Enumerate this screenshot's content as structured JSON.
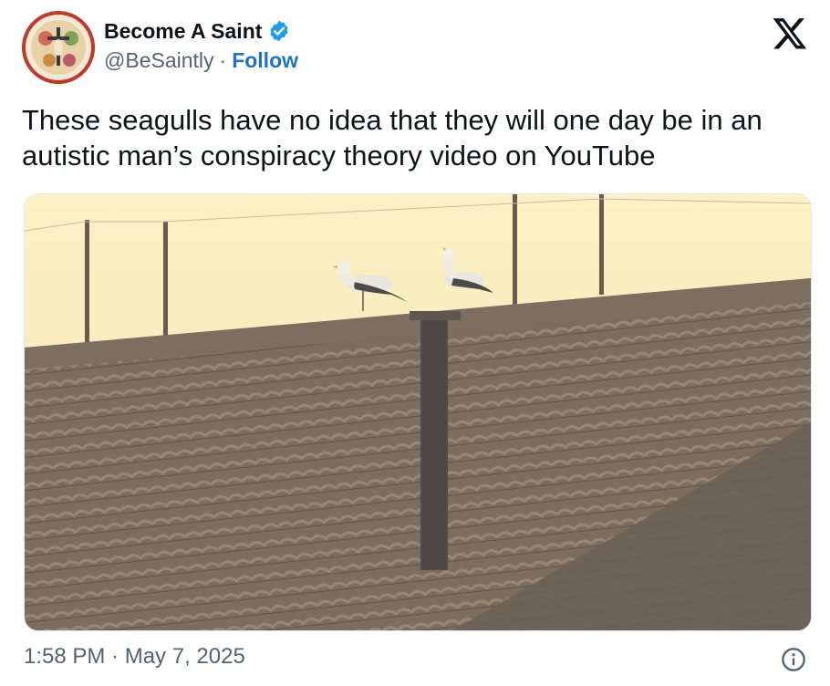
{
  "author": {
    "display_name": "Become A Saint",
    "handle": "@BeSaintly",
    "separator": "·",
    "follow_label": "Follow",
    "verified": true
  },
  "tweet": {
    "text": "These seagulls have no idea that they will one day be in an autistic man’s conspiracy theory video on YouTube",
    "timestamp": "1:58 PM · May 7, 2025"
  },
  "icons": {
    "brand": "x-logo-icon",
    "verified": "verified-badge-icon",
    "info": "info-icon"
  },
  "colors": {
    "link": "#1d74c6",
    "verified": "#1d9bf0",
    "secondary_text": "#536471"
  }
}
